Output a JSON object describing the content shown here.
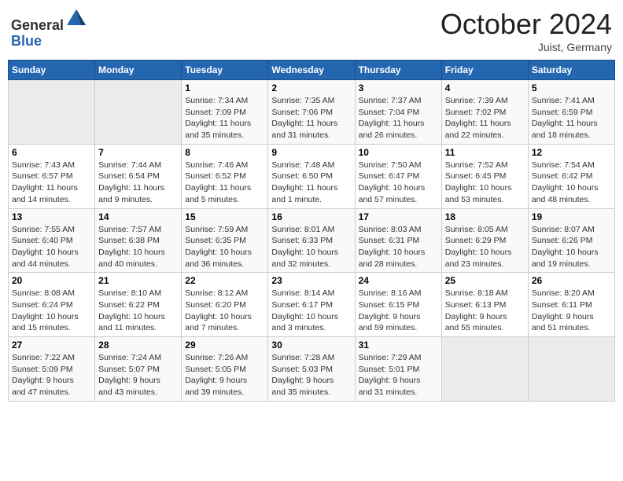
{
  "header": {
    "logo": {
      "line1": "General",
      "line2": "Blue"
    },
    "title": "October 2024",
    "subtitle": "Juist, Germany"
  },
  "weekdays": [
    "Sunday",
    "Monday",
    "Tuesday",
    "Wednesday",
    "Thursday",
    "Friday",
    "Saturday"
  ],
  "weeks": [
    [
      {
        "day": "",
        "info": ""
      },
      {
        "day": "",
        "info": ""
      },
      {
        "day": "1",
        "info": "Sunrise: 7:34 AM\nSunset: 7:09 PM\nDaylight: 11 hours\nand 35 minutes."
      },
      {
        "day": "2",
        "info": "Sunrise: 7:35 AM\nSunset: 7:06 PM\nDaylight: 11 hours\nand 31 minutes."
      },
      {
        "day": "3",
        "info": "Sunrise: 7:37 AM\nSunset: 7:04 PM\nDaylight: 11 hours\nand 26 minutes."
      },
      {
        "day": "4",
        "info": "Sunrise: 7:39 AM\nSunset: 7:02 PM\nDaylight: 11 hours\nand 22 minutes."
      },
      {
        "day": "5",
        "info": "Sunrise: 7:41 AM\nSunset: 6:59 PM\nDaylight: 11 hours\nand 18 minutes."
      }
    ],
    [
      {
        "day": "6",
        "info": "Sunrise: 7:43 AM\nSunset: 6:57 PM\nDaylight: 11 hours\nand 14 minutes."
      },
      {
        "day": "7",
        "info": "Sunrise: 7:44 AM\nSunset: 6:54 PM\nDaylight: 11 hours\nand 9 minutes."
      },
      {
        "day": "8",
        "info": "Sunrise: 7:46 AM\nSunset: 6:52 PM\nDaylight: 11 hours\nand 5 minutes."
      },
      {
        "day": "9",
        "info": "Sunrise: 7:48 AM\nSunset: 6:50 PM\nDaylight: 11 hours\nand 1 minute."
      },
      {
        "day": "10",
        "info": "Sunrise: 7:50 AM\nSunset: 6:47 PM\nDaylight: 10 hours\nand 57 minutes."
      },
      {
        "day": "11",
        "info": "Sunrise: 7:52 AM\nSunset: 6:45 PM\nDaylight: 10 hours\nand 53 minutes."
      },
      {
        "day": "12",
        "info": "Sunrise: 7:54 AM\nSunset: 6:42 PM\nDaylight: 10 hours\nand 48 minutes."
      }
    ],
    [
      {
        "day": "13",
        "info": "Sunrise: 7:55 AM\nSunset: 6:40 PM\nDaylight: 10 hours\nand 44 minutes."
      },
      {
        "day": "14",
        "info": "Sunrise: 7:57 AM\nSunset: 6:38 PM\nDaylight: 10 hours\nand 40 minutes."
      },
      {
        "day": "15",
        "info": "Sunrise: 7:59 AM\nSunset: 6:35 PM\nDaylight: 10 hours\nand 36 minutes."
      },
      {
        "day": "16",
        "info": "Sunrise: 8:01 AM\nSunset: 6:33 PM\nDaylight: 10 hours\nand 32 minutes."
      },
      {
        "day": "17",
        "info": "Sunrise: 8:03 AM\nSunset: 6:31 PM\nDaylight: 10 hours\nand 28 minutes."
      },
      {
        "day": "18",
        "info": "Sunrise: 8:05 AM\nSunset: 6:29 PM\nDaylight: 10 hours\nand 23 minutes."
      },
      {
        "day": "19",
        "info": "Sunrise: 8:07 AM\nSunset: 6:26 PM\nDaylight: 10 hours\nand 19 minutes."
      }
    ],
    [
      {
        "day": "20",
        "info": "Sunrise: 8:08 AM\nSunset: 6:24 PM\nDaylight: 10 hours\nand 15 minutes."
      },
      {
        "day": "21",
        "info": "Sunrise: 8:10 AM\nSunset: 6:22 PM\nDaylight: 10 hours\nand 11 minutes."
      },
      {
        "day": "22",
        "info": "Sunrise: 8:12 AM\nSunset: 6:20 PM\nDaylight: 10 hours\nand 7 minutes."
      },
      {
        "day": "23",
        "info": "Sunrise: 8:14 AM\nSunset: 6:17 PM\nDaylight: 10 hours\nand 3 minutes."
      },
      {
        "day": "24",
        "info": "Sunrise: 8:16 AM\nSunset: 6:15 PM\nDaylight: 9 hours\nand 59 minutes."
      },
      {
        "day": "25",
        "info": "Sunrise: 8:18 AM\nSunset: 6:13 PM\nDaylight: 9 hours\nand 55 minutes."
      },
      {
        "day": "26",
        "info": "Sunrise: 8:20 AM\nSunset: 6:11 PM\nDaylight: 9 hours\nand 51 minutes."
      }
    ],
    [
      {
        "day": "27",
        "info": "Sunrise: 7:22 AM\nSunset: 5:09 PM\nDaylight: 9 hours\nand 47 minutes."
      },
      {
        "day": "28",
        "info": "Sunrise: 7:24 AM\nSunset: 5:07 PM\nDaylight: 9 hours\nand 43 minutes."
      },
      {
        "day": "29",
        "info": "Sunrise: 7:26 AM\nSunset: 5:05 PM\nDaylight: 9 hours\nand 39 minutes."
      },
      {
        "day": "30",
        "info": "Sunrise: 7:28 AM\nSunset: 5:03 PM\nDaylight: 9 hours\nand 35 minutes."
      },
      {
        "day": "31",
        "info": "Sunrise: 7:29 AM\nSunset: 5:01 PM\nDaylight: 9 hours\nand 31 minutes."
      },
      {
        "day": "",
        "info": ""
      },
      {
        "day": "",
        "info": ""
      }
    ]
  ]
}
